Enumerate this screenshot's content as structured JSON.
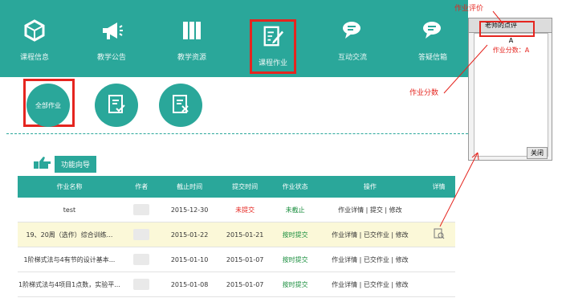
{
  "nav": {
    "items": [
      {
        "label": "课程信息",
        "icon": "cube-icon"
      },
      {
        "label": "教学公告",
        "icon": "megaphone-icon"
      },
      {
        "label": "教学资源",
        "icon": "books-icon"
      },
      {
        "label": "课程作业",
        "icon": "edit-doc-icon"
      },
      {
        "label": "互动交流",
        "icon": "chat-icon"
      },
      {
        "label": "答疑信箱",
        "icon": "chat-mail-icon"
      }
    ],
    "active_index": 3
  },
  "circles": {
    "all_label": "全部作业"
  },
  "func_guide": "功能向导",
  "table": {
    "headers": [
      "作业名称",
      "作者",
      "截止时间",
      "提交时间",
      "作业状态",
      "操作",
      "详情"
    ],
    "rows": [
      {
        "name": "test",
        "deadline": "2015-12-30",
        "submitted": "未提交",
        "status": "未截止",
        "ops": "作业详情 | 提交 | 修改"
      },
      {
        "name": "19、20周（选作）综合训练...",
        "deadline": "2015-01-22",
        "submitted": "2015-01-21",
        "status": "按时提交",
        "ops": "作业详情 | 已交作业 | 修改"
      },
      {
        "name": "1阶梯式法与4有节的设计基本...",
        "deadline": "2015-01-10",
        "submitted": "2015-01-07",
        "status": "按时提交",
        "ops": "作业详情 | 已交作业 | 修改"
      },
      {
        "name": "1阶梯式法与4项目1点数，实验平...",
        "deadline": "2015-01-08",
        "submitted": "2015-01-07",
        "status": "按时提交",
        "ops": "作业详情 | 已交作业 | 修改"
      }
    ]
  },
  "popup": {
    "title": "老师的点评",
    "line1": "A",
    "line2": "作业分数：A",
    "button": "关闭"
  },
  "annotations": {
    "top": "作业评价",
    "middle": "作业分数"
  },
  "colors": {
    "teal": "#2aa79a",
    "red": "#e5251f"
  }
}
